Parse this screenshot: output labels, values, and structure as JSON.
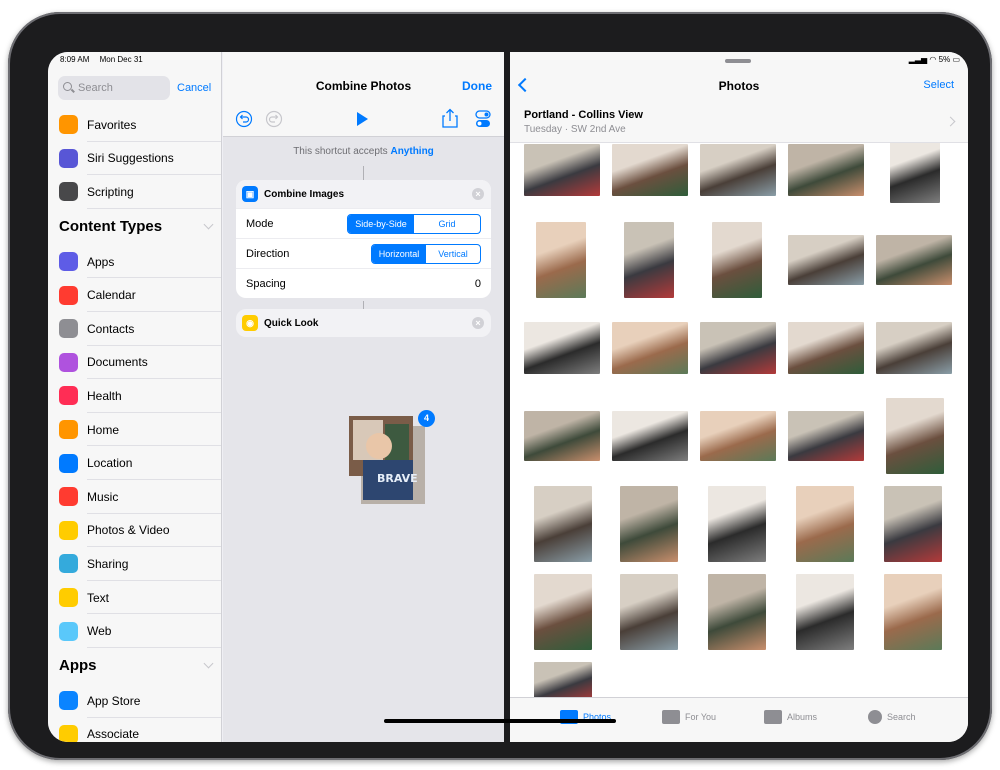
{
  "status": {
    "time": "8:09 AM",
    "date": "Mon Dec 31",
    "battery": "5%"
  },
  "sidebar": {
    "search_placeholder": "Search",
    "cancel_label": "Cancel",
    "top_items": [
      {
        "label": "Favorites",
        "icon": "star-icon",
        "color": "#ff9500"
      },
      {
        "label": "Siri Suggestions",
        "icon": "siri-icon",
        "color": "#5856d6"
      },
      {
        "label": "Scripting",
        "icon": "scripting-icon",
        "color": "#48484a"
      }
    ],
    "content_types_heading": "Content Types",
    "content_items": [
      {
        "label": "Apps",
        "icon": "apps-icon",
        "color": "#5e5ce6"
      },
      {
        "label": "Calendar",
        "icon": "calendar-icon",
        "color": "#ff3b30"
      },
      {
        "label": "Contacts",
        "icon": "contacts-icon",
        "color": "#8e8e93"
      },
      {
        "label": "Documents",
        "icon": "documents-icon",
        "color": "#af52de"
      },
      {
        "label": "Health",
        "icon": "health-icon",
        "color": "#ff2d55"
      },
      {
        "label": "Home",
        "icon": "home-icon",
        "color": "#ff9500"
      },
      {
        "label": "Location",
        "icon": "location-icon",
        "color": "#007aff"
      },
      {
        "label": "Music",
        "icon": "music-icon",
        "color": "#ff3b30"
      },
      {
        "label": "Photos & Video",
        "icon": "photos-icon",
        "color": "#ffcc00"
      },
      {
        "label": "Sharing",
        "icon": "sharing-icon",
        "color": "#34aadc"
      },
      {
        "label": "Text",
        "icon": "text-icon",
        "color": "#ffcc00"
      },
      {
        "label": "Web",
        "icon": "web-icon",
        "color": "#5ac8fa"
      }
    ],
    "apps_heading": "Apps",
    "app_items": [
      {
        "label": "App Store",
        "icon": "app-store-icon",
        "color": "#0a84ff"
      },
      {
        "label": "Associate",
        "icon": "associate-icon",
        "color": "#ffcc00"
      }
    ]
  },
  "editor": {
    "title": "Combine Photos",
    "done_label": "Done",
    "accepts_text": "This shortcut accepts",
    "accepts_value": "Anything",
    "combine_card": {
      "title": "Combine Images",
      "mode_label": "Mode",
      "mode_options": [
        "Side-by-Side",
        "Grid"
      ],
      "mode_selected": "Side-by-Side",
      "direction_label": "Direction",
      "direction_options": [
        "Horizontal",
        "Vertical"
      ],
      "direction_selected": "Horizontal",
      "spacing_label": "Spacing",
      "spacing_value": "0"
    },
    "quicklook_card": {
      "title": "Quick Look"
    },
    "drag_count": "4"
  },
  "photos": {
    "title": "Photos",
    "select_label": "Select",
    "location_title": "Portland - Collins View",
    "location_subtitle": "Tuesday  ·  SW 2nd Ave",
    "tabs": [
      {
        "label": "Photos",
        "icon": "photos-tab-icon",
        "active": true
      },
      {
        "label": "For You",
        "icon": "for-you-icon",
        "active": false
      },
      {
        "label": "Albums",
        "icon": "albums-icon",
        "active": false
      },
      {
        "label": "Search",
        "icon": "search-tab-icon",
        "active": false
      }
    ]
  }
}
